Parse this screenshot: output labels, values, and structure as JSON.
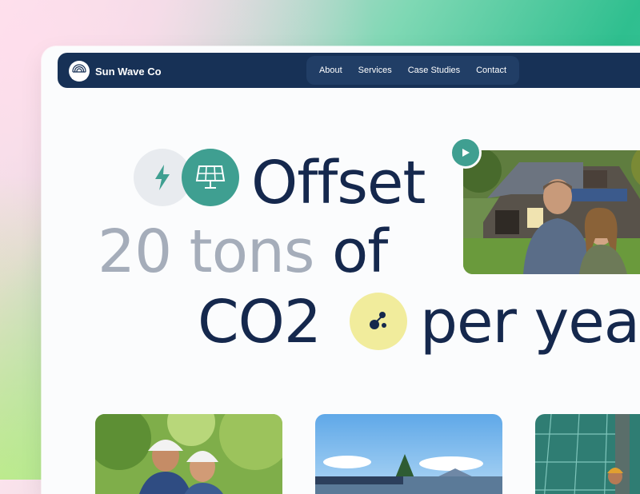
{
  "brand": {
    "name": "Sun Wave Co"
  },
  "nav": {
    "items": [
      "About",
      "Services",
      "Case Studies",
      "Contact"
    ]
  },
  "hero": {
    "line1": "Offset",
    "line2_muted": "20 tons",
    "line2_rest": "of",
    "line3_a": "CO2",
    "line3_b": "per yea"
  },
  "icons": {
    "bolt": "lightning-bolt-icon",
    "panel": "solar-panel-icon",
    "molecule": "molecule-icon",
    "play": "play-icon"
  },
  "colors": {
    "navy": "#173156",
    "teal": "#3f9f91",
    "yellow": "#f1ec9c",
    "muted_text": "#a5adba"
  }
}
